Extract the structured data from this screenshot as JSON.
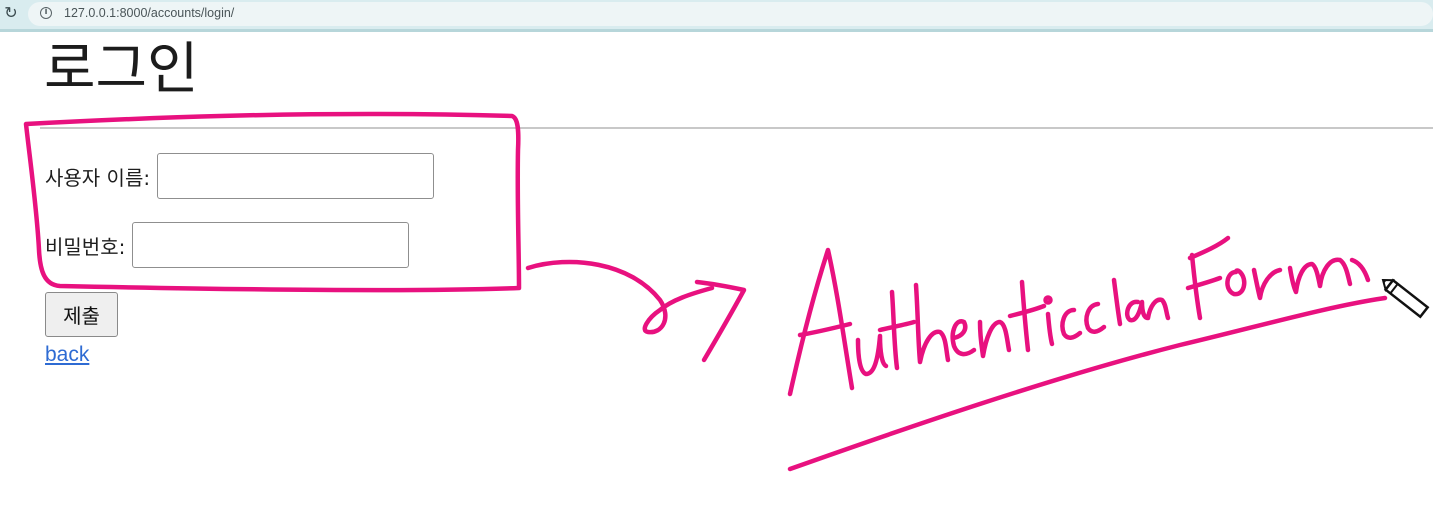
{
  "browser": {
    "url": "127.0.0.1:8000/accounts/login/"
  },
  "page": {
    "title": "로그인",
    "username_label": "사용자 이름:",
    "username_value": "",
    "password_label": "비밀번호:",
    "password_value": "",
    "submit_label": "제출",
    "back_link": "back"
  },
  "annotation": {
    "handwritten_text": "AuthenticationForm",
    "ink_color": "#e8117f"
  }
}
